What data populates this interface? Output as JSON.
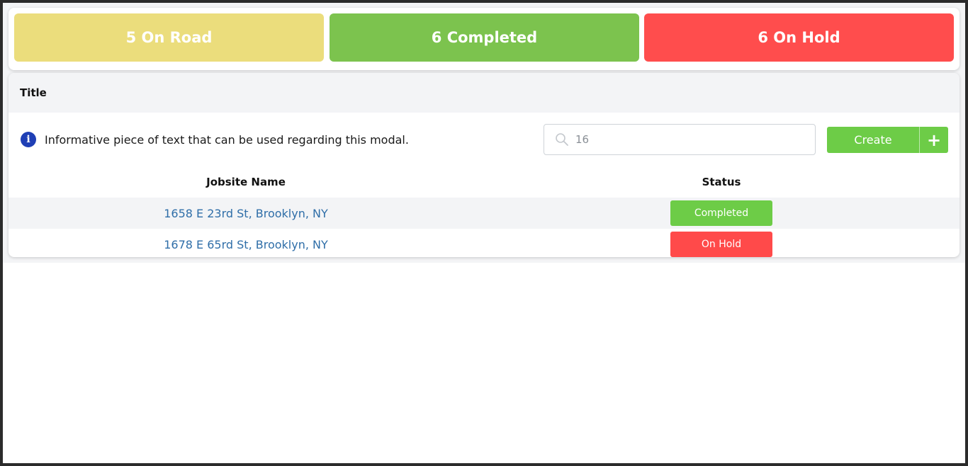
{
  "colors": {
    "on_road": "#ebdd7c",
    "completed": "#7cc34e",
    "on_hold": "#ff4d4d",
    "completed_badge": "#6dcc47",
    "on_hold_badge": "#ff4a4a"
  },
  "stats": [
    {
      "label": "5 On Road",
      "status": "on_road"
    },
    {
      "label": "6 Completed",
      "status": "completed"
    },
    {
      "label": "6 On Hold",
      "status": "on_hold"
    }
  ],
  "panel": {
    "title": "Title",
    "info_text": "Informative piece of text that can be used regarding this modal.",
    "info_icon": "info-icon",
    "search": {
      "value": "16",
      "placeholder": "",
      "icon": "search-icon"
    },
    "create_label": "Create",
    "create_plus": "+"
  },
  "table": {
    "headers": {
      "name": "Jobsite Name",
      "status": "Status"
    },
    "rows": [
      {
        "name": "1658 E 23rd St, Brooklyn, NY",
        "status": "Completed",
        "status_key": "completed"
      },
      {
        "name": "1678 E 65rd St, Brooklyn, NY",
        "status": "On Hold",
        "status_key": "on_hold"
      }
    ]
  }
}
